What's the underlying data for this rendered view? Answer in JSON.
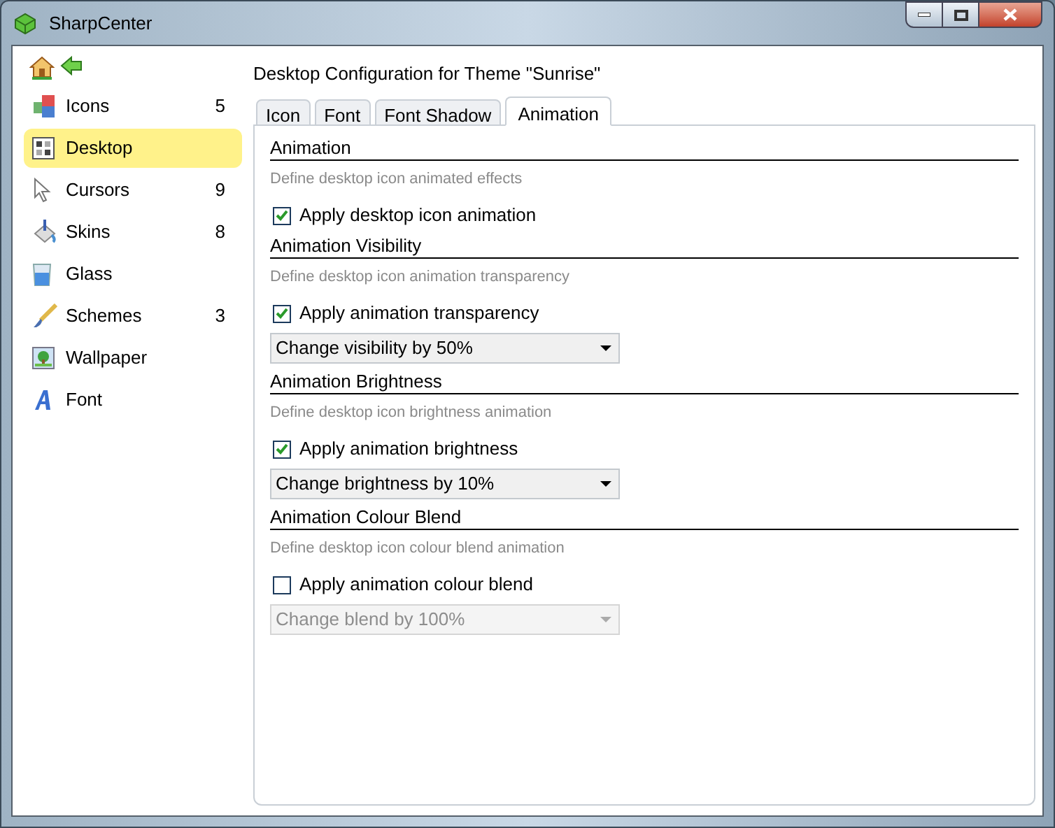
{
  "window": {
    "title": "SharpCenter"
  },
  "sidebar": {
    "items": [
      {
        "label": "Icons",
        "count": "5",
        "selected": false
      },
      {
        "label": "Desktop",
        "selected": true
      },
      {
        "label": "Cursors",
        "count": "9",
        "selected": false
      },
      {
        "label": "Skins",
        "count": "8",
        "selected": false
      },
      {
        "label": "Glass",
        "selected": false
      },
      {
        "label": "Schemes",
        "count": "3",
        "selected": false
      },
      {
        "label": "Wallpaper",
        "selected": false
      },
      {
        "label": "Font",
        "selected": false
      }
    ]
  },
  "heading": "Desktop Configuration for Theme \"Sunrise\"",
  "tabs": [
    {
      "label": "Icon",
      "selected": false
    },
    {
      "label": "Font",
      "selected": false
    },
    {
      "label": "Font Shadow",
      "selected": false
    },
    {
      "label": "Animation",
      "selected": true
    }
  ],
  "sections": [
    {
      "title": "Animation",
      "description": "Define desktop icon animated effects",
      "checkbox": {
        "label": "Apply desktop icon animation",
        "checked": true
      }
    },
    {
      "title": "Animation Visibility",
      "description": "Define desktop icon animation transparency",
      "checkbox": {
        "label": "Apply animation transparency",
        "checked": true
      },
      "dropdown": {
        "value": "Change visibility by 50%",
        "disabled": false
      }
    },
    {
      "title": "Animation Brightness",
      "description": "Define desktop icon brightness animation",
      "checkbox": {
        "label": "Apply animation brightness",
        "checked": true
      },
      "dropdown": {
        "value": "Change brightness by 10%",
        "disabled": false
      }
    },
    {
      "title": "Animation Colour Blend",
      "description": "Define desktop icon colour blend animation",
      "checkbox": {
        "label": "Apply animation colour blend",
        "checked": false
      },
      "dropdown": {
        "value": "Change blend by 100%",
        "disabled": true
      }
    }
  ]
}
